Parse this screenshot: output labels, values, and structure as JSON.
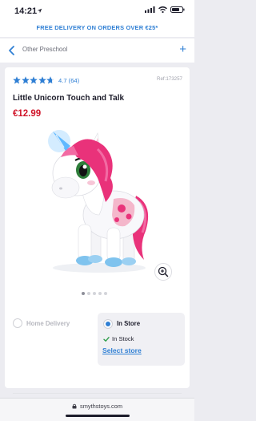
{
  "status_bar": {
    "time": "14:21"
  },
  "banner": {
    "text": "FREE DELIVERY ON ORDERS OVER €25*"
  },
  "nav": {
    "title": "Other Preschool"
  },
  "product": {
    "rating_text": "4.7 (64)",
    "rating_value": 4.7,
    "rating_max": 5,
    "ref": "Ref:173257",
    "title": "Little Unicorn Touch and Talk",
    "price": "€12.99",
    "image_count": 5,
    "active_image": 1
  },
  "fulfilment": {
    "home_delivery_label": "Home Delivery",
    "in_store_label": "In Store",
    "stock_text": "In Stock",
    "select_store_label": "Select store"
  },
  "browser": {
    "url": "smythstoys.com"
  },
  "colors": {
    "accent": "#2f7fd4",
    "price": "#d0152a",
    "stock_check": "#2e9e4a"
  }
}
